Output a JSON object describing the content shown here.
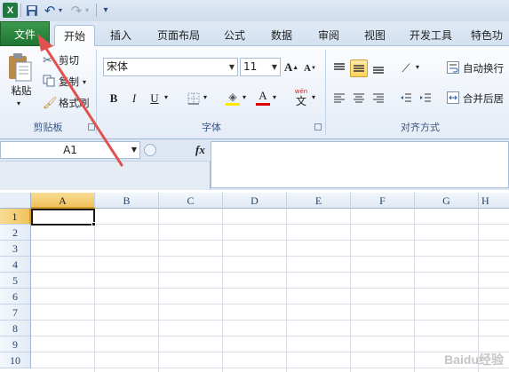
{
  "qat": {
    "logo": "X",
    "undo": "↶",
    "redo": "↷",
    "more": "▾"
  },
  "tabs": {
    "file": "文件",
    "items": [
      "开始",
      "插入",
      "页面布局",
      "公式",
      "数据",
      "审阅",
      "视图",
      "开发工具",
      "特色功"
    ]
  },
  "clipboard": {
    "paste": "粘贴",
    "cut": "剪切",
    "copy": "复制",
    "format_painter": "格式刷",
    "group_label": "剪贴板"
  },
  "font": {
    "name": "宋体",
    "size": "11",
    "bold": "B",
    "italic": "I",
    "underline": "U",
    "grow": "A",
    "shrink": "A",
    "font_color": "A",
    "phonetic": "wén",
    "phonetic_char": "文",
    "group_label": "字体"
  },
  "alignment": {
    "wrap_text": "自动换行",
    "merge_center": "合并后居",
    "group_label": "对齐方式"
  },
  "formula_bar": {
    "name_box": "A1",
    "fx": "fx",
    "formula": ""
  },
  "sheet": {
    "columns": [
      "A",
      "B",
      "C",
      "D",
      "E",
      "F",
      "G",
      "H"
    ],
    "rows": [
      "1",
      "2",
      "3",
      "4",
      "5",
      "6",
      "7",
      "8",
      "9",
      "10"
    ],
    "selected_cell": "A1"
  },
  "watermark": "Baidu经验",
  "colors": {
    "accent": "#1f7432",
    "arrow": "#e0524f",
    "highlight": "#ffd35c",
    "font_red": "#e00000"
  }
}
